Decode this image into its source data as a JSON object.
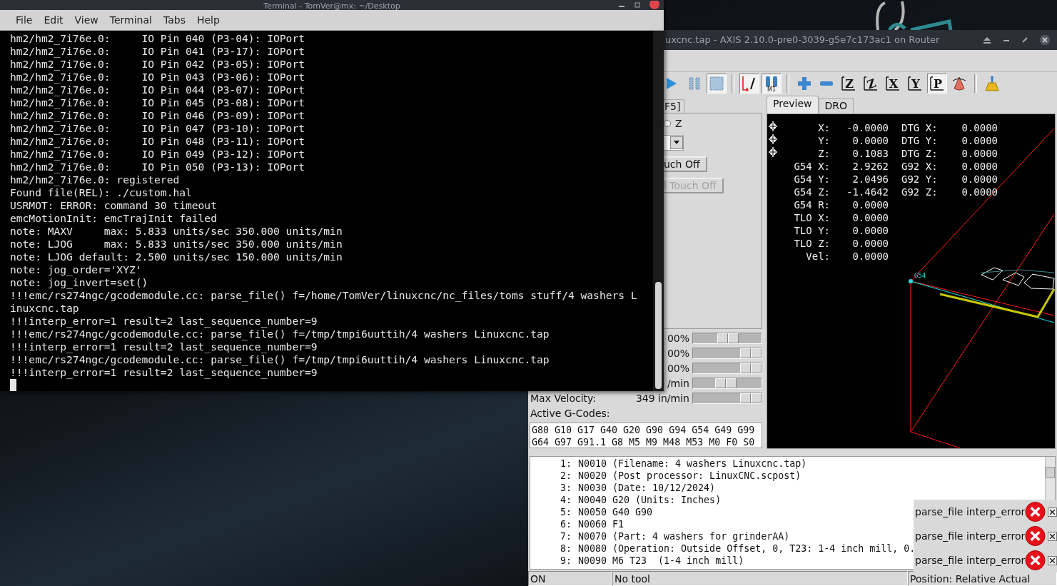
{
  "terminal": {
    "title": "Terminal - TomVer@mx: ~/Desktop",
    "menu": [
      "File",
      "Edit",
      "View",
      "Terminal",
      "Tabs",
      "Help"
    ],
    "lines": [
      "hm2/hm2_7i76e.0:     IO Pin 040 (P3-04): IOPort",
      "hm2/hm2_7i76e.0:     IO Pin 041 (P3-17): IOPort",
      "hm2/hm2_7i76e.0:     IO Pin 042 (P3-05): IOPort",
      "hm2/hm2_7i76e.0:     IO Pin 043 (P3-06): IOPort",
      "hm2/hm2_7i76e.0:     IO Pin 044 (P3-07): IOPort",
      "hm2/hm2_7i76e.0:     IO Pin 045 (P3-08): IOPort",
      "hm2/hm2_7i76e.0:     IO Pin 046 (P3-09): IOPort",
      "hm2/hm2_7i76e.0:     IO Pin 047 (P3-10): IOPort",
      "hm2/hm2_7i76e.0:     IO Pin 048 (P3-11): IOPort",
      "hm2/hm2_7i76e.0:     IO Pin 049 (P3-12): IOPort",
      "hm2/hm2_7i76e.0:     IO Pin 050 (P3-13): IOPort",
      "hm2/hm2_7i76e.0: registered",
      "Found file(REL): ./custom.hal",
      "USRMOT: ERROR: command 30 timeout",
      "emcMotionInit: emcTrajInit failed",
      "note: MAXV     max: 5.833 units/sec 350.000 units/min",
      "note: LJOG     max: 5.833 units/sec 350.000 units/min",
      "note: LJOG default: 2.500 units/sec 150.000 units/min",
      "note: jog_order='XYZ'",
      "note: jog_invert=set()",
      "!!!emc/rs274ngc/gcodemodule.cc: parse_file() f=/home/TomVer/linuxcnc/nc_files/toms stuff/4 washers L",
      "inuxcnc.tap",
      "!!!interp_error=1 result=2 last_sequence_number=9",
      "!!!emc/rs274ngc/gcodemodule.cc: parse_file() f=/tmp/tmpi6uuttih/4 washers Linuxcnc.tap",
      "!!!interp_error=1 result=2 last_sequence_number=9",
      "!!!emc/rs274ngc/gcodemodule.cc: parse_file() f=/tmp/tmpi6uuttih/4 washers Linuxcnc.tap",
      "!!!interp_error=1 result=2 last_sequence_number=9"
    ]
  },
  "axis": {
    "title": "uxcnc.tap - AXIS 2.10.0-pre0-3039-g5e7c173ac1 on Router",
    "toolbar": [
      {
        "kind": "play",
        "pressed": false
      },
      {
        "kind": "pause",
        "pressed": false
      },
      {
        "kind": "stop",
        "pressed": true
      },
      {
        "kind": "sep"
      },
      {
        "kind": "skip",
        "pressed": true
      },
      {
        "kind": "optstop",
        "label": "M1",
        "pressed": true
      },
      {
        "kind": "sep"
      },
      {
        "kind": "zoomin",
        "pressed": false
      },
      {
        "kind": "zoomout",
        "pressed": false
      },
      {
        "kind": "viewz",
        "label": "Z",
        "pressed": false
      },
      {
        "kind": "viewz2",
        "label": "Z",
        "pressed": false
      },
      {
        "kind": "viewx",
        "label": "X",
        "pressed": false
      },
      {
        "kind": "viewy",
        "label": "Y",
        "pressed": false
      },
      {
        "kind": "viewp",
        "label": "P",
        "pressed": true
      },
      {
        "kind": "rotate",
        "pressed": false
      },
      {
        "kind": "sep"
      },
      {
        "kind": "clear",
        "pressed": false
      }
    ],
    "control_tab": {
      "label": "F5]",
      "selected": false
    },
    "axis_radio": {
      "label": "Z",
      "selected": false
    },
    "touch_off": "uch Off",
    "tool_touch_off": {
      "label": "l Touch Off",
      "disabled": true
    },
    "overrides": [
      {
        "reading": "00%",
        "level": 0.52
      },
      {
        "reading": "00%",
        "level": 1
      },
      {
        "reading": "00%",
        "level": 1
      },
      {
        "reading": "/min",
        "level": 0.47
      }
    ],
    "max_velocity": {
      "label": "Max Velocity:",
      "reading": "349 in/min",
      "level": 1
    },
    "active_gcodes_label": "Active G-Codes:",
    "active_gcodes": [
      "G80 G10 G17 G40 G20 G90 G94 G54 G49 G99",
      "G64 G97 G91.1 G8 M5 M9 M48 M53 M0 F0 S0"
    ],
    "view_tabs": [
      {
        "label": "Preview",
        "selected": true
      },
      {
        "label": "DRO",
        "selected": false
      }
    ],
    "dro": [
      {
        "label": "X:",
        "value": "-0.0000",
        "label2": "DTG X:",
        "value2": "0.0000",
        "homed": true
      },
      {
        "label": "Y:",
        "value": "0.0000",
        "label2": "DTG Y:",
        "value2": "0.0000",
        "homed": true
      },
      {
        "label": "Z:",
        "value": "0.1083",
        "label2": "DTG Z:",
        "value2": "0.0000",
        "homed": true
      },
      {
        "label": "G54 X:",
        "value": "2.9262",
        "label2": "G92 X:",
        "value2": "0.0000",
        "homed": false
      },
      {
        "label": "G54 Y:",
        "value": "2.0496",
        "label2": "G92 Y:",
        "value2": "0.0000",
        "homed": false
      },
      {
        "label": "G54 Z:",
        "value": "-1.4642",
        "label2": "G92 Z:",
        "value2": "0.0000",
        "homed": false
      },
      {
        "label": "G54 R:",
        "value": "0.0000",
        "homed": false
      },
      {
        "label": "TLO X:",
        "value": "0.0000",
        "homed": false
      },
      {
        "label": "TLO Y:",
        "value": "0.0000",
        "homed": false
      },
      {
        "label": "TLO Z:",
        "value": "0.0000",
        "homed": false
      },
      {
        "label": "Vel:",
        "value": "0.0000",
        "homed": false
      }
    ],
    "origin_label": "G54",
    "gcode": [
      {
        "number": "1:",
        "text": "N0010 (Filename: 4 washers Linuxcnc.tap)"
      },
      {
        "number": "2:",
        "text": "N0020 (Post processor: LinuxCNC.scpost)"
      },
      {
        "number": "3:",
        "text": "N0030 (Date: 10/12/2024)"
      },
      {
        "number": "4:",
        "text": "N0040 G20 (Units: Inches)"
      },
      {
        "number": "5:",
        "text": "N0050 G40 G90"
      },
      {
        "number": "6:",
        "text": "N0060 F1"
      },
      {
        "number": "7:",
        "text": "N0070 (Part: 4 washers for grinderAA)"
      },
      {
        "number": "8:",
        "text": "N0080 (Operation: Outside Offset, 0, T23: 1-4 inch mill, 0."
      },
      {
        "number": "9:",
        "text": "N0090 M6 T23  (1-4 inch mill)"
      }
    ],
    "status": [
      "ON",
      "No tool",
      "Position: Relative Actual"
    ],
    "notifications": [
      {
        "message": "parse_file interp_error"
      },
      {
        "message": "parse_file interp_error"
      },
      {
        "message": "parse_file interp_error"
      }
    ]
  }
}
